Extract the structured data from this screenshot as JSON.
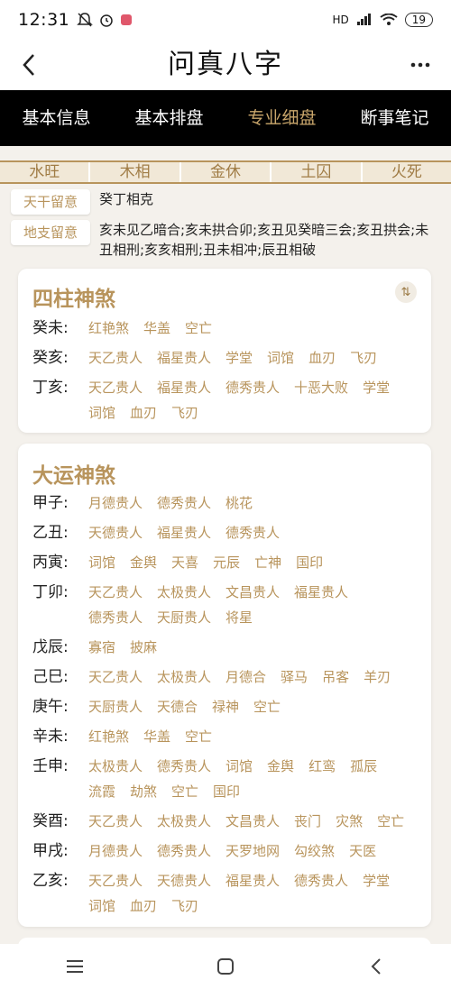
{
  "status": {
    "time": "12:31",
    "signal": "HD",
    "battery": "19"
  },
  "header": {
    "title": "问真八字"
  },
  "tabs": [
    {
      "label": "基本信息"
    },
    {
      "label": "基本排盘"
    },
    {
      "label": "专业细盘"
    },
    {
      "label": "断事笔记"
    }
  ],
  "season": [
    "水旺",
    "木相",
    "金休",
    "土囚",
    "火死"
  ],
  "notes": {
    "tiangan": {
      "tag": "天干留意",
      "text": "癸丁相克"
    },
    "dizhi": {
      "tag": "地支留意",
      "text": "亥未见乙暗合;亥未拱合卯;亥丑见癸暗三会;亥丑拱会;未丑相刑;亥亥相刑;丑未相冲;辰丑相破"
    }
  },
  "sizhu": {
    "title": "四柱神煞",
    "sort_icon": "⇅",
    "rows": [
      {
        "gz": "癸未:",
        "items": [
          "红艳煞",
          "华盖",
          "空亡"
        ]
      },
      {
        "gz": "癸亥:",
        "items": [
          "天乙贵人",
          "福星贵人",
          "学堂",
          "词馆",
          "血刃",
          "飞刃"
        ]
      },
      {
        "gz": "丁亥:",
        "items": [
          "天乙贵人",
          "福星贵人",
          "德秀贵人",
          "十恶大败",
          "学堂",
          "词馆",
          "血刃",
          "飞刃"
        ]
      }
    ]
  },
  "dayun": {
    "title": "大运神煞",
    "rows": [
      {
        "gz": "甲子:",
        "items": [
          "月德贵人",
          "德秀贵人",
          "桃花"
        ]
      },
      {
        "gz": "乙丑:",
        "items": [
          "天德贵人",
          "福星贵人",
          "德秀贵人"
        ]
      },
      {
        "gz": "丙寅:",
        "items": [
          "词馆",
          "金舆",
          "天喜",
          "元辰",
          "亡神",
          "国印"
        ]
      },
      {
        "gz": "丁卯:",
        "items": [
          "天乙贵人",
          "太极贵人",
          "文昌贵人",
          "福星贵人",
          "德秀贵人",
          "天厨贵人",
          "将星"
        ]
      },
      {
        "gz": "戊辰:",
        "items": [
          "寡宿",
          "披麻"
        ]
      },
      {
        "gz": "己巳:",
        "items": [
          "天乙贵人",
          "太极贵人",
          "月德合",
          "驿马",
          "吊客",
          "羊刃"
        ]
      },
      {
        "gz": "庚午:",
        "items": [
          "天厨贵人",
          "天德合",
          "禄神",
          "空亡"
        ]
      },
      {
        "gz": "辛未:",
        "items": [
          "红艳煞",
          "华盖",
          "空亡"
        ]
      },
      {
        "gz": "壬申:",
        "items": [
          "太极贵人",
          "德秀贵人",
          "词馆",
          "金舆",
          "红鸾",
          "孤辰",
          "流霞",
          "劫煞",
          "空亡",
          "国印"
        ]
      },
      {
        "gz": "癸酉:",
        "items": [
          "天乙贵人",
          "太极贵人",
          "文昌贵人",
          "丧门",
          "灾煞",
          "空亡"
        ]
      },
      {
        "gz": "甲戌:",
        "items": [
          "月德贵人",
          "德秀贵人",
          "天罗地网",
          "勾绞煞",
          "天医"
        ]
      },
      {
        "gz": "乙亥:",
        "items": [
          "天乙贵人",
          "天德贵人",
          "福星贵人",
          "德秀贵人",
          "学堂",
          "词馆",
          "血刃",
          "飞刃"
        ]
      }
    ]
  },
  "colors": {
    "accent": "#b8945c",
    "tab_bg": "#000000",
    "active_tab": "#c9a66b"
  }
}
